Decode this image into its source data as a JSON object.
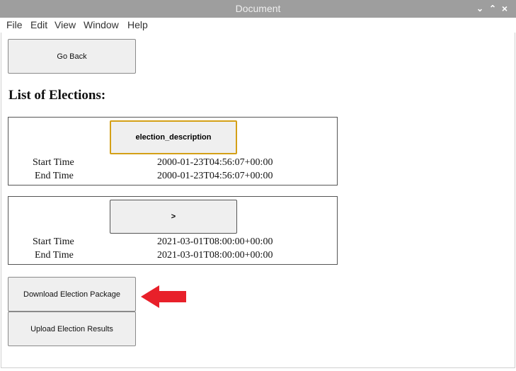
{
  "window": {
    "title": "Document",
    "controls": [
      "⌄",
      "⌃",
      "×"
    ]
  },
  "menu": [
    "File",
    "Edit",
    "View",
    "Window",
    "Help"
  ],
  "go_back_label": "Go Back",
  "heading": "List of Elections:",
  "elections": [
    {
      "button_label": "election_description",
      "focused": true,
      "start_label": "Start Time",
      "start_value": "2000-01-23T04:56:07+00:00",
      "end_label": "End Time",
      "end_value": "2000-01-23T04:56:07+00:00"
    },
    {
      "button_label": ">",
      "focused": false,
      "start_label": "Start Time",
      "start_value": "2021-03-01T08:00:00+00:00",
      "end_label": "End Time",
      "end_value": "2021-03-01T08:00:00+00:00"
    }
  ],
  "actions": {
    "download_label": "Download Election Package",
    "upload_label": "Upload Election Results"
  },
  "colors": {
    "annotation_arrow": "#e8202a",
    "focus_border": "#d4a017"
  }
}
